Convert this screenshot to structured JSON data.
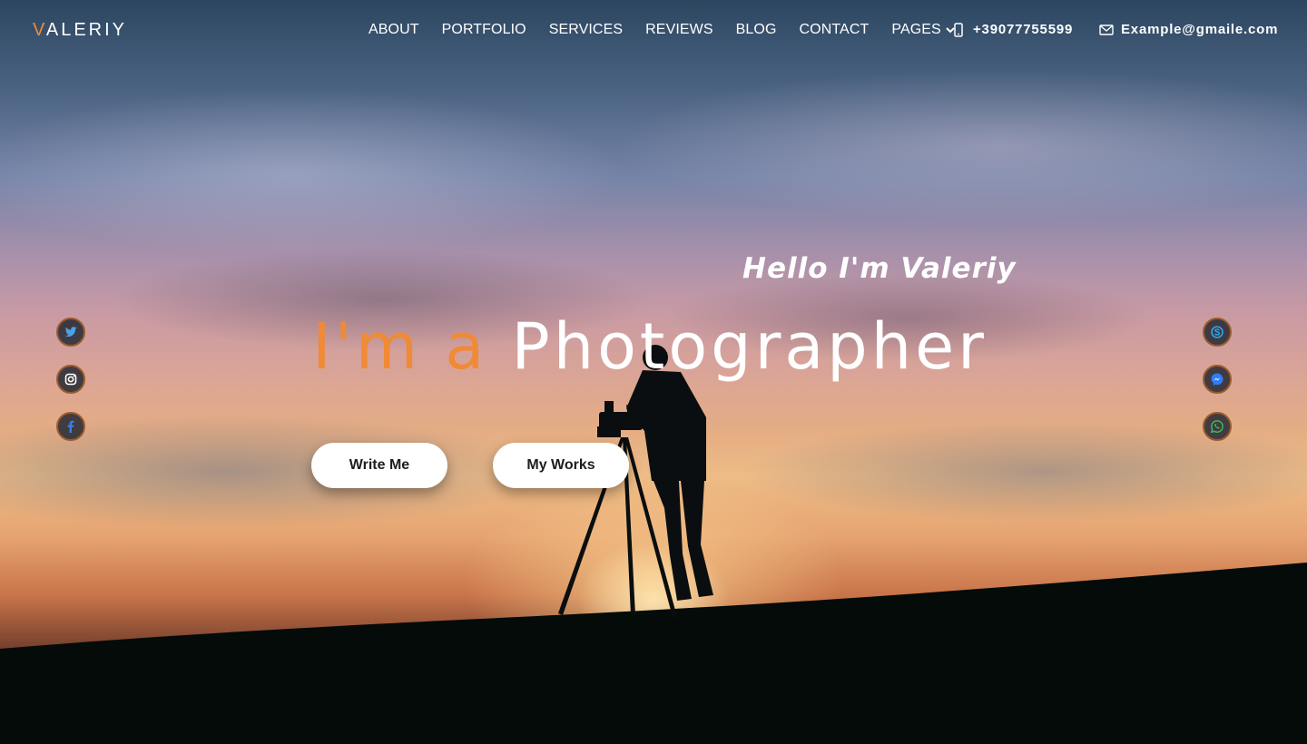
{
  "brand": {
    "logo_first": "V",
    "logo_rest": "ALERIY"
  },
  "nav": {
    "items": [
      {
        "label": "ABOUT"
      },
      {
        "label": "PORTFOLIO"
      },
      {
        "label": "SERVICES"
      },
      {
        "label": "REVIEWS"
      },
      {
        "label": "BLOG"
      },
      {
        "label": "CONTACT"
      },
      {
        "label": "PAGES"
      }
    ]
  },
  "contact": {
    "phone": "+39077755599",
    "email": "Example@gmaile.com"
  },
  "hero": {
    "greeting": "Hello I'm Valeriy",
    "headline_accent": "I'm a",
    "headline_main": "Photographer",
    "write_button": "Write Me",
    "works_button": "My Works"
  },
  "social": {
    "left": [
      "twitter-icon",
      "instagram-icon",
      "facebook-icon"
    ],
    "right": [
      "skype-icon",
      "messenger-icon",
      "whatsapp-icon"
    ]
  },
  "colors": {
    "accent": "#f08a35",
    "text": "#ffffff",
    "button_bg": "#ffffff",
    "button_text": "#1d1d1d"
  }
}
